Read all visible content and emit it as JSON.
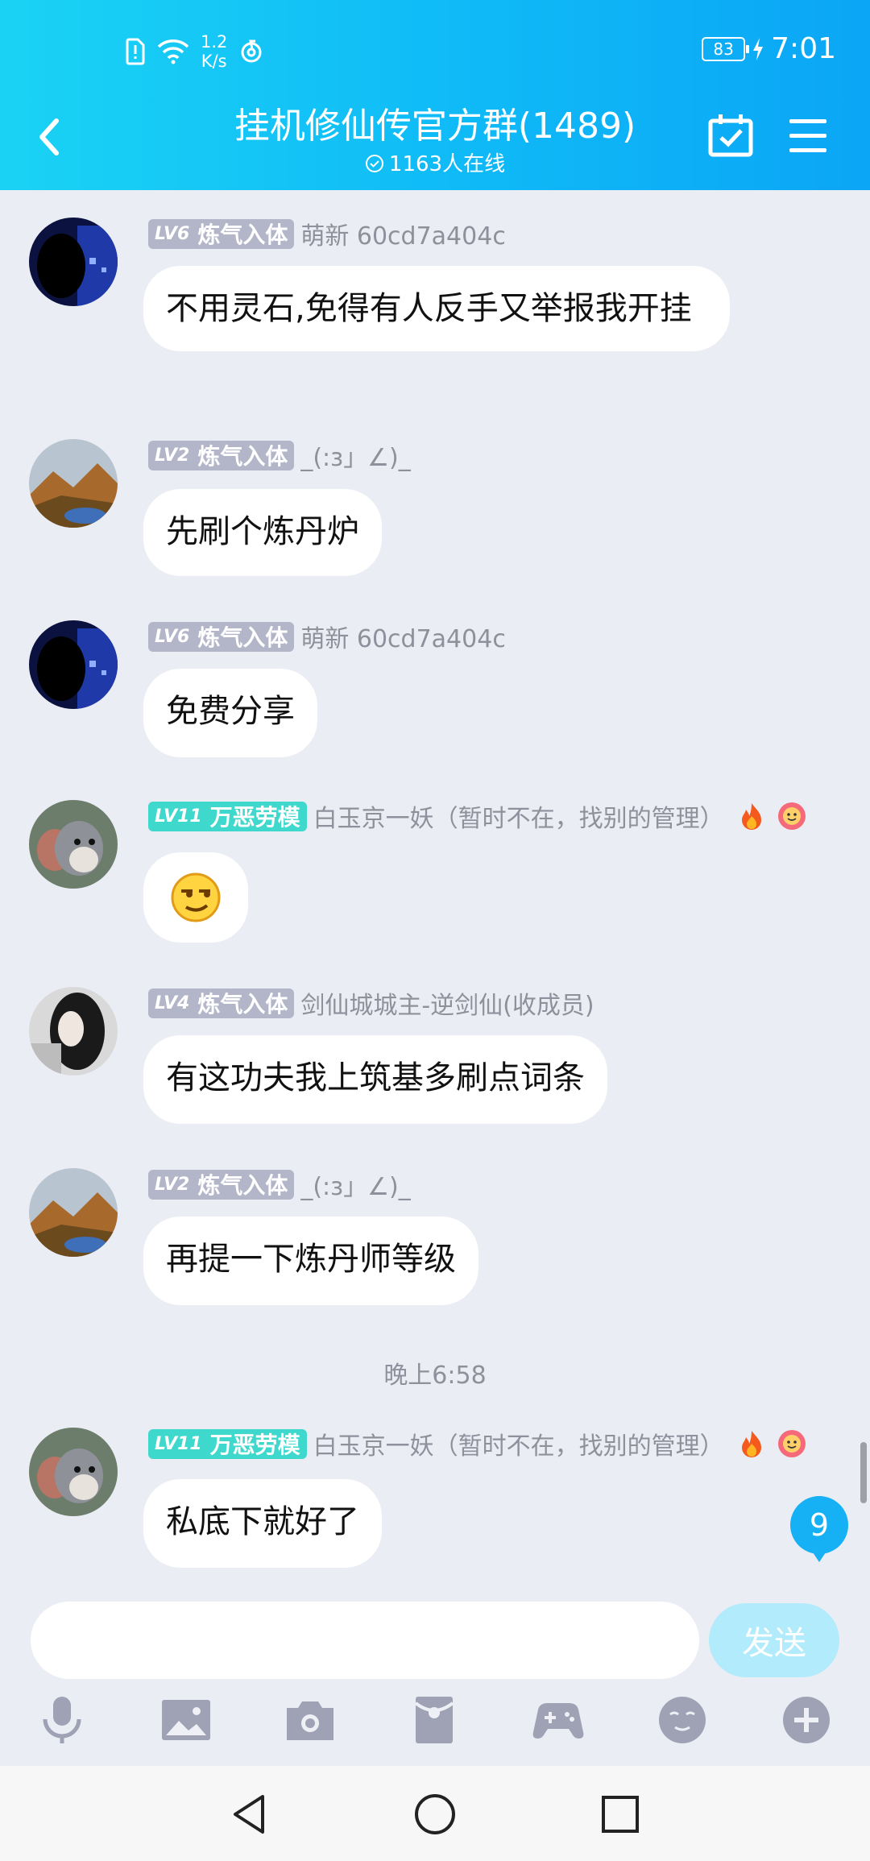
{
  "status_bar": {
    "net_speed_value": "1.2",
    "net_speed_unit": "K/s",
    "battery": "83",
    "time": "7:01"
  },
  "header": {
    "title": "挂机修仙传官方群(1489)",
    "online": "1163人在线"
  },
  "messages": [
    {
      "badge_level": "LV6",
      "badge_title": "炼气入体",
      "nick": "萌新 60cd7a404c",
      "text": "不用灵石,免得有人反手又举报我开挂"
    },
    {
      "badge_level": "LV2",
      "badge_title": "炼气入体",
      "nick": "_(:з」∠)_",
      "text": "先刷个炼丹炉"
    },
    {
      "badge_level": "LV6",
      "badge_title": "炼气入体",
      "nick": "萌新 60cd7a404c",
      "text": "免费分享"
    },
    {
      "badge_level": "LV11",
      "badge_title": "万恶劳模",
      "nick": "白玉京一妖（暂时不在，找别的管理）",
      "text": ""
    },
    {
      "badge_level": "LV4",
      "badge_title": "炼气入体",
      "nick": "剑仙城城主-逆剑仙(收成员)",
      "text": "有这功夫我上筑基多刷点词条"
    },
    {
      "badge_level": "LV2",
      "badge_title": "炼气入体",
      "nick": "_(:з」∠)_",
      "text": "再提一下炼丹师等级"
    },
    {
      "badge_level": "LV11",
      "badge_title": "万恶劳模",
      "nick": "白玉京一妖（暂时不在，找别的管理）",
      "text": "私底下就好了"
    }
  ],
  "timestamp": "晚上6:58",
  "unread_count": "9",
  "input": {
    "placeholder": "",
    "send_label": "发送"
  },
  "colors": {
    "header_start": "#1ad3f4",
    "header_end": "#0ba6f5",
    "accent": "#16b0f5",
    "badge_gray": "#b3b6c8",
    "badge_teal": "#3fd8cc"
  },
  "icons": [
    "microphone-icon",
    "image-icon",
    "camera-icon",
    "red-packet-icon",
    "gamepad-icon",
    "emoji-icon",
    "plus-icon"
  ]
}
